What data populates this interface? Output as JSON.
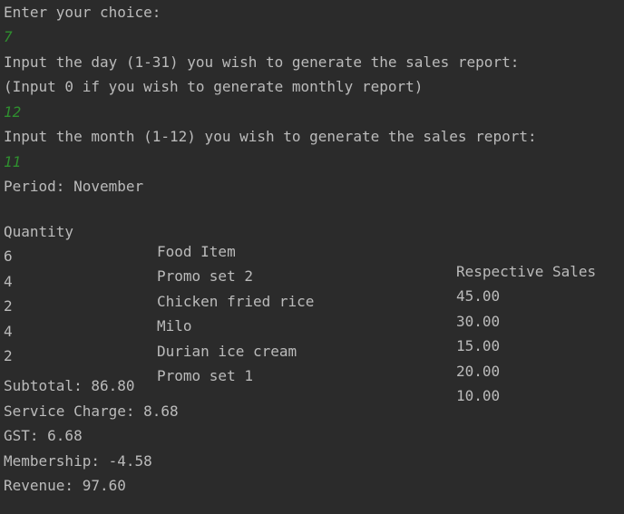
{
  "prompts": {
    "choice": "Enter your choice:",
    "choice_input": "7",
    "day": "Input the day (1-31) you wish to generate the sales report:",
    "day_hint": "(Input 0 if you wish to generate monthly report)",
    "day_input": "12",
    "month": "Input the month (1-12) you wish to generate the sales report:",
    "month_input": "11"
  },
  "report": {
    "period": "Period: November",
    "headers": {
      "quantity": "Quantity",
      "item": "Food Item",
      "sales": "Respective Sales"
    },
    "rows": [
      {
        "quantity": "6",
        "item": "Promo set 2",
        "sales": "45.00"
      },
      {
        "quantity": "4",
        "item": "Chicken fried rice",
        "sales": "30.00"
      },
      {
        "quantity": "2",
        "item": "Milo",
        "sales": "15.00"
      },
      {
        "quantity": "4",
        "item": "Durian ice cream",
        "sales": "20.00"
      },
      {
        "quantity": "2",
        "item": "Promo set 1",
        "sales": "10.00"
      }
    ],
    "totals": {
      "subtotal": "Subtotal: 86.80",
      "service_charge": "Service Charge: 8.68",
      "gst": "GST: 6.68",
      "membership": "Membership: -4.58",
      "revenue": "Revenue: 97.60"
    }
  },
  "colors": {
    "background": "#2b2b2b",
    "text": "#bbbbbb",
    "user_input": "#2f8f2f"
  }
}
